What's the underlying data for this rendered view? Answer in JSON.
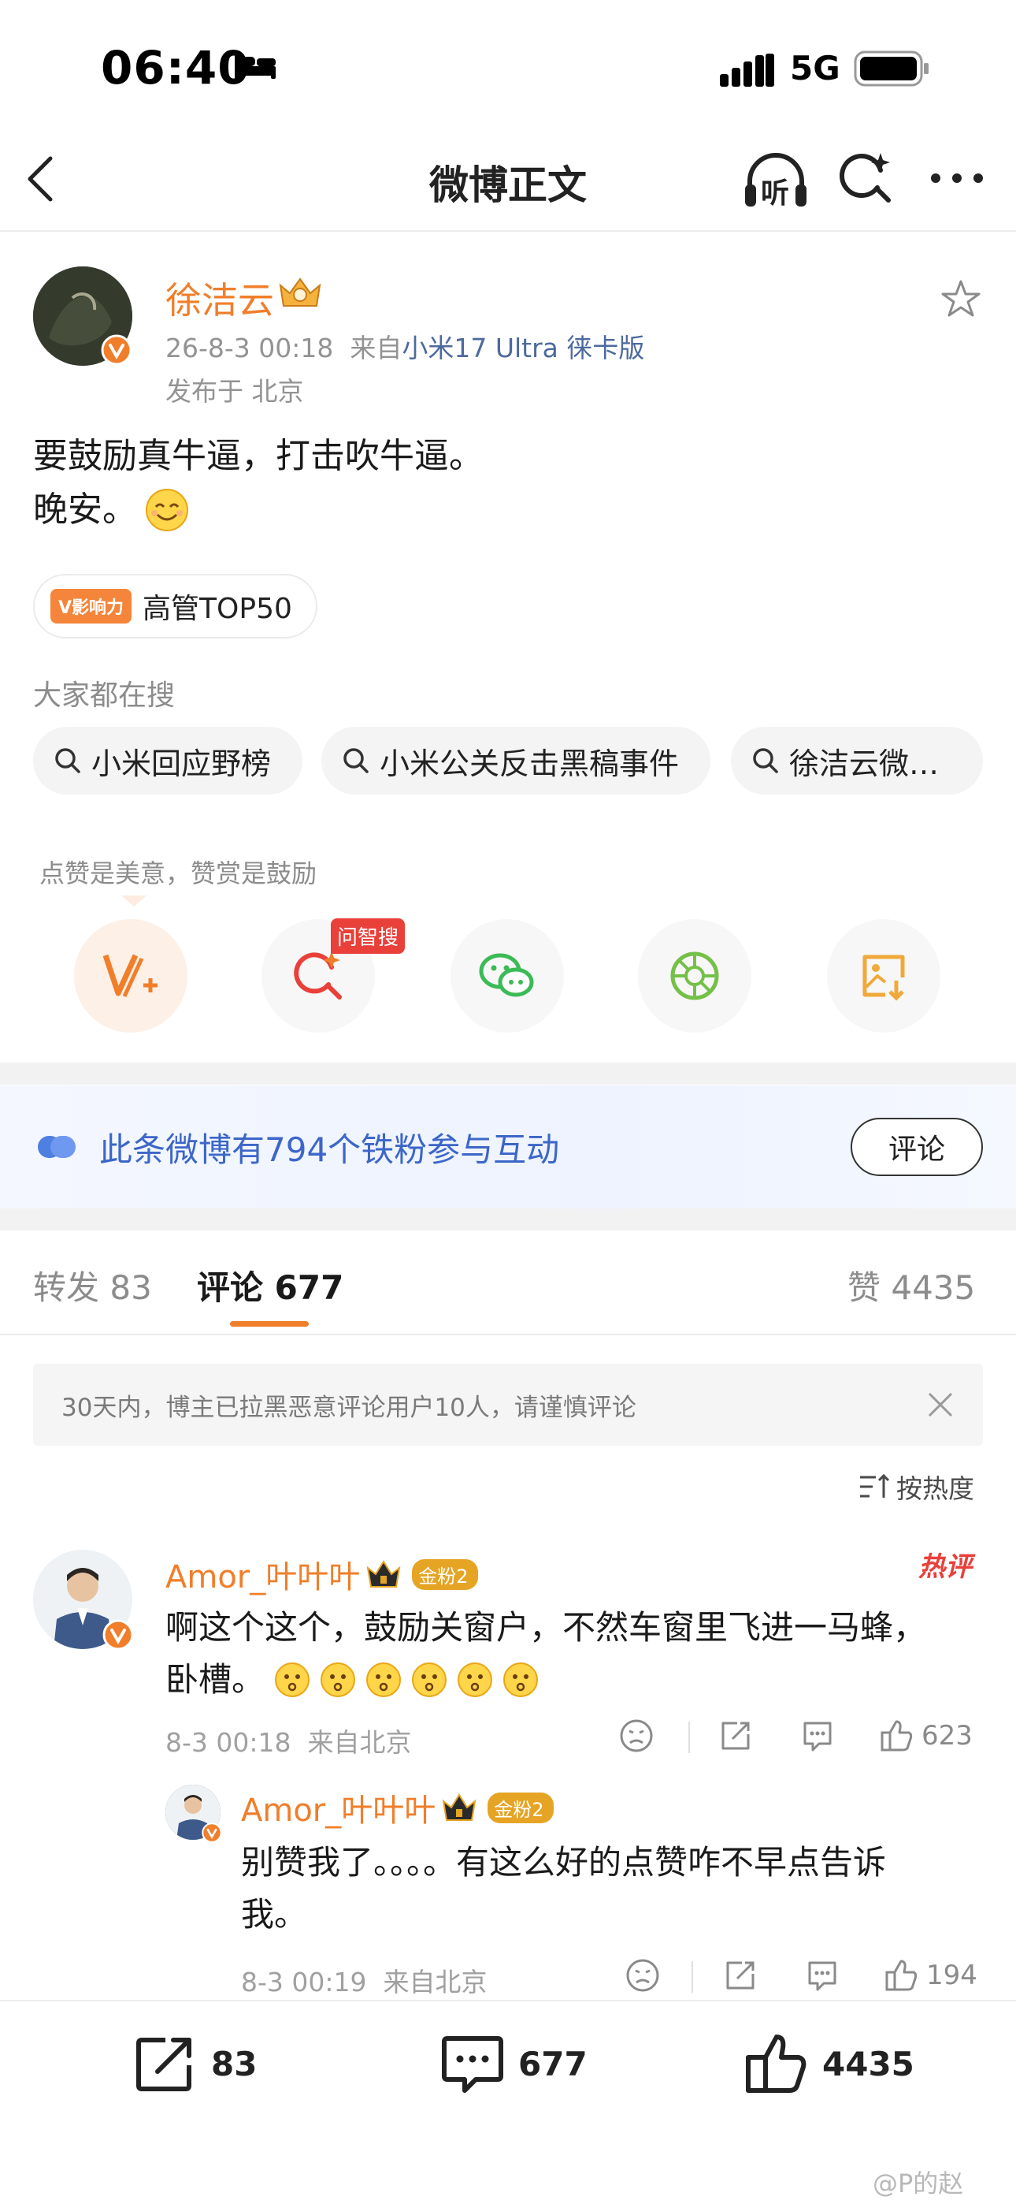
{
  "status_bar": {
    "time": "06:40",
    "network": "5G"
  },
  "nav": {
    "title": "微博正文",
    "listen_icon": "listen-headphone-icon",
    "listen_label": "听"
  },
  "author": {
    "name": "徐洁云",
    "time": "26-8-3 00:18",
    "source_prefix": "来自",
    "source": "小米17 Ultra 徕卡版",
    "location": "发布于 北京"
  },
  "post": {
    "line1": "要鼓励真牛逼，打击吹牛逼。",
    "line2": "晚安。"
  },
  "influence": {
    "tag": "V影响力",
    "label": "高管TOP50"
  },
  "search": {
    "title": "大家都在搜",
    "chips": [
      "小米回应野榜",
      "小米公关反击黑稿事件",
      "徐洁云微…"
    ]
  },
  "reward": {
    "tip": "点赞是美意，赞赏是鼓励",
    "badge": "问智搜"
  },
  "fans": {
    "text": "此条微博有794个铁粉参与互动",
    "button": "评论"
  },
  "tabs": {
    "repost": "转发 83",
    "comment": "评论 677",
    "like": "赞 4435"
  },
  "notice": "30天内，博主已拉黑恶意评论用户10人，请谨慎评论",
  "sort": "按热度",
  "comments": [
    {
      "name": "Amor_叶叶叶",
      "badge": "金粉2",
      "hot": "热评",
      "line1": "啊这个这个，鼓励关窗户，不然车窗里飞进一马蜂，",
      "line2": "卧槽。",
      "meta": "8-3 00:18  来自北京",
      "likes": "623"
    }
  ],
  "reply": {
    "name": "Amor_叶叶叶",
    "badge": "金粉2",
    "line1": "别赞我了。。。。有这么好的点赞咋不早点告诉",
    "line2": "我。",
    "meta": "8-3 00:19  来自北京",
    "likes": "194"
  },
  "bottom": {
    "repost": "83",
    "comment": "677",
    "like": "4435"
  },
  "watermark": "@P的赵",
  "colors": {
    "accent": "#f07e2a",
    "link": "#4d6a9e",
    "fans_blue": "#3c66c8",
    "hot_red": "#e9403a"
  }
}
